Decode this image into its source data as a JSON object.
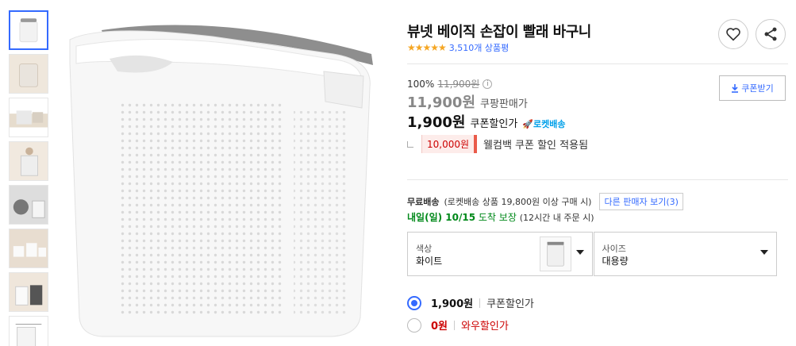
{
  "product": {
    "title": "뷰넷 베이직 손잡이 빨래 바구니",
    "stars": "★★★★★",
    "review_count": "3,510개 상품평",
    "rating": 5
  },
  "pricing": {
    "discount_rate": "100%",
    "original_price": "11,900원",
    "sale_price": "11,900원",
    "sale_label": "쿠팡판매가",
    "coupon_price": "1,900원",
    "coupon_label": "쿠폰할인가",
    "rocket_badge": "로켓배송",
    "welcome_amount": "10,000원",
    "welcome_text": "웰컴백 쿠폰 할인 적용됨",
    "coupon_button": "쿠폰받기"
  },
  "shipping": {
    "free_label": "무료배송",
    "free_detail": "(로켓배송 상품 19,800원 이상 구매 시)",
    "other_sellers": "다른 판매자 보기(3)",
    "delivery_day": "내일(일) 10/15",
    "delivery_arrive": "도착 보장",
    "delivery_note": "(12시간 내 주문 시)"
  },
  "options": {
    "color_label": "색상",
    "color_value": "화이트",
    "size_label": "사이즈",
    "size_value": "대용량"
  },
  "price_options": [
    {
      "price": "1,900원",
      "label": "쿠폰할인가",
      "selected": true
    },
    {
      "price": "0원",
      "label": "와우할인가",
      "selected": false
    }
  ],
  "colors": {
    "accent": "#346aff",
    "star": "#f5a623",
    "green": "#00891a",
    "red": "#cc0000"
  },
  "icons": {
    "heart": "heart-icon",
    "share": "share-icon",
    "download": "download-icon",
    "info": "info-icon",
    "rocket": "rocket-icon"
  }
}
